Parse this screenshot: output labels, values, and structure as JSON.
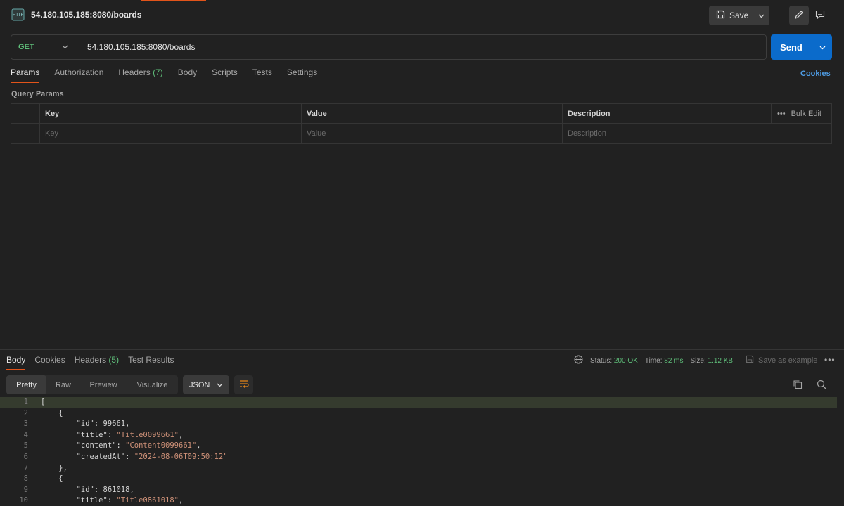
{
  "header": {
    "icon": "http-icon",
    "title": "54.180.105.185:8080/boards",
    "save_label": "Save"
  },
  "request": {
    "method": "GET",
    "url": "54.180.105.185:8080/boards",
    "send_label": "Send"
  },
  "request_tabs": [
    {
      "label": "Params",
      "count": ""
    },
    {
      "label": "Authorization",
      "count": ""
    },
    {
      "label": "Headers",
      "count": "(7)"
    },
    {
      "label": "Body",
      "count": ""
    },
    {
      "label": "Scripts",
      "count": ""
    },
    {
      "label": "Tests",
      "count": ""
    },
    {
      "label": "Settings",
      "count": ""
    }
  ],
  "cookies_label": "Cookies",
  "query_params": {
    "label": "Query Params",
    "columns": [
      "Key",
      "Value",
      "Description"
    ],
    "bulk_edit": "Bulk Edit",
    "placeholders": [
      "Key",
      "Value",
      "Description"
    ]
  },
  "response": {
    "tabs": [
      {
        "label": "Body",
        "count": ""
      },
      {
        "label": "Cookies",
        "count": ""
      },
      {
        "label": "Headers",
        "count": "(5)"
      },
      {
        "label": "Test Results",
        "count": ""
      }
    ],
    "status_label": "Status:",
    "status_value": "200 OK",
    "time_label": "Time:",
    "time_value": "82 ms",
    "size_label": "Size:",
    "size_value": "1.12 KB",
    "save_example": "Save as example",
    "view_modes": [
      "Pretty",
      "Raw",
      "Preview",
      "Visualize"
    ],
    "format": "JSON"
  },
  "code_lines": [
    "[",
    "    {",
    "        \"id\": 99661,",
    "        \"title\": \"Title0099661\",",
    "        \"content\": \"Content0099661\",",
    "        \"createdAt\": \"2024-08-06T09:50:12\"",
    "    },",
    "    {",
    "        \"id\": 861018,",
    "        \"title\": \"Title0861018\","
  ],
  "colors": {
    "accent": "#e2541a",
    "send": "#0b6bcb",
    "status_ok": "#5fbf7a",
    "link": "#4e9de6"
  }
}
